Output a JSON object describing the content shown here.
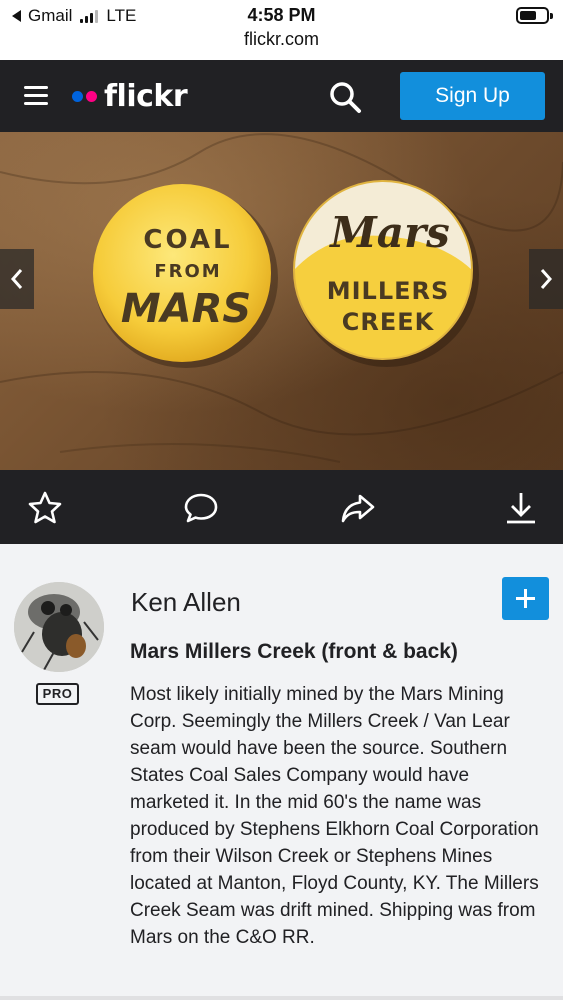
{
  "status": {
    "back_app": "Gmail",
    "network": "LTE",
    "time": "4:58 PM",
    "url": "flickr.com"
  },
  "header": {
    "logo_text": "flickr",
    "logo_dot_colors": [
      "#0063dc",
      "#ff0084"
    ],
    "signup_label": "Sign Up",
    "menu_icon": "hamburger-icon",
    "search_icon": "search-icon"
  },
  "photo": {
    "pin_left": {
      "line1": "COAL",
      "line2": "FROM",
      "line3": "MARS"
    },
    "pin_right": {
      "top": "Mars",
      "line1": "MILLERS",
      "line2": "CREEK"
    },
    "prev_icon": "chevron-left-icon",
    "next_icon": "chevron-right-icon"
  },
  "actions": [
    {
      "name": "favorite",
      "icon": "star-icon"
    },
    {
      "name": "comment",
      "icon": "comment-icon"
    },
    {
      "name": "share",
      "icon": "share-icon"
    },
    {
      "name": "download",
      "icon": "download-icon"
    }
  ],
  "info": {
    "author": "Ken Allen",
    "badge": "PRO",
    "follow_icon": "plus-icon",
    "title": "Mars Millers Creek (front & back)",
    "description": "Most likely initially mined by the Mars Mining Corp. Seemingly the Millers Creek / Van Lear seam would have been the source. Southern States Coal Sales Company would have marketed it. In the mid 60's the name was produced by Stephens Elkhorn Coal Corporation from their Wilson Creek or Stephens Mines located at Manton, Floyd County, KY. The Millers Creek Seam was drift mined. Shipping was from Mars on the C&O RR."
  },
  "colors": {
    "accent": "#128fdc",
    "dark_bar": "#212124",
    "page_bg": "#f2f3f5",
    "pin_yellow": "#f6c935"
  }
}
